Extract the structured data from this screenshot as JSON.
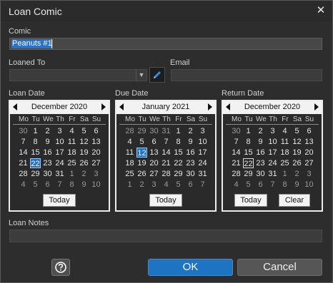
{
  "window": {
    "title": "Loan Comic"
  },
  "comic": {
    "label": "Comic",
    "value": "Peanuts #1"
  },
  "loaned_to": {
    "label": "Loaned To",
    "value": ""
  },
  "email": {
    "label": "Email",
    "value": ""
  },
  "loan_date": {
    "label": "Loan Date",
    "month": "December 2020",
    "days": [
      "30",
      "1",
      "2",
      "3",
      "4",
      "5",
      "6",
      "7",
      "8",
      "9",
      "10",
      "11",
      "12",
      "13",
      "14",
      "15",
      "16",
      "17",
      "18",
      "19",
      "20",
      "21",
      "22",
      "23",
      "24",
      "25",
      "26",
      "27",
      "28",
      "29",
      "30",
      "31",
      "1",
      "2",
      "3",
      "4",
      "5",
      "6",
      "7",
      "8",
      "9",
      "10"
    ],
    "other_month": [
      0,
      32,
      33,
      34,
      35,
      36,
      37,
      38,
      39,
      40,
      41
    ],
    "selected": 22,
    "today_button": "Today"
  },
  "due_date": {
    "label": "Due Date",
    "month": "January 2021",
    "days": [
      "28",
      "29",
      "30",
      "31",
      "1",
      "2",
      "3",
      "4",
      "5",
      "6",
      "7",
      "8",
      "9",
      "10",
      "11",
      "12",
      "13",
      "14",
      "15",
      "16",
      "17",
      "18",
      "19",
      "20",
      "21",
      "22",
      "23",
      "24",
      "25",
      "26",
      "27",
      "28",
      "29",
      "30",
      "31",
      "1",
      "2",
      "3",
      "4",
      "5",
      "6",
      "7"
    ],
    "other_month": [
      0,
      1,
      2,
      3,
      35,
      36,
      37,
      38,
      39,
      40,
      41
    ],
    "selected": 15,
    "today_button": "Today"
  },
  "return_date": {
    "label": "Return Date",
    "month": "December 2020",
    "days": [
      "30",
      "1",
      "2",
      "3",
      "4",
      "5",
      "6",
      "7",
      "8",
      "9",
      "10",
      "11",
      "12",
      "13",
      "14",
      "15",
      "16",
      "17",
      "18",
      "19",
      "20",
      "21",
      "22",
      "23",
      "24",
      "25",
      "26",
      "27",
      "28",
      "29",
      "30",
      "31",
      "1",
      "2",
      "3",
      "4",
      "5",
      "6",
      "7",
      "8",
      "9",
      "10"
    ],
    "other_month": [
      0,
      32,
      33,
      34,
      35,
      36,
      37,
      38,
      39,
      40,
      41
    ],
    "today_outline": 22,
    "today_button": "Today",
    "clear_button": "Clear"
  },
  "weekdays": [
    "Mo",
    "Tu",
    "We",
    "Th",
    "Fr",
    "Sa",
    "Su"
  ],
  "loan_notes": {
    "label": "Loan Notes",
    "value": ""
  },
  "buttons": {
    "ok": "OK",
    "cancel": "Cancel"
  },
  "colors": {
    "accent": "#1e73c2",
    "selected_day": "#1f6fc5"
  }
}
